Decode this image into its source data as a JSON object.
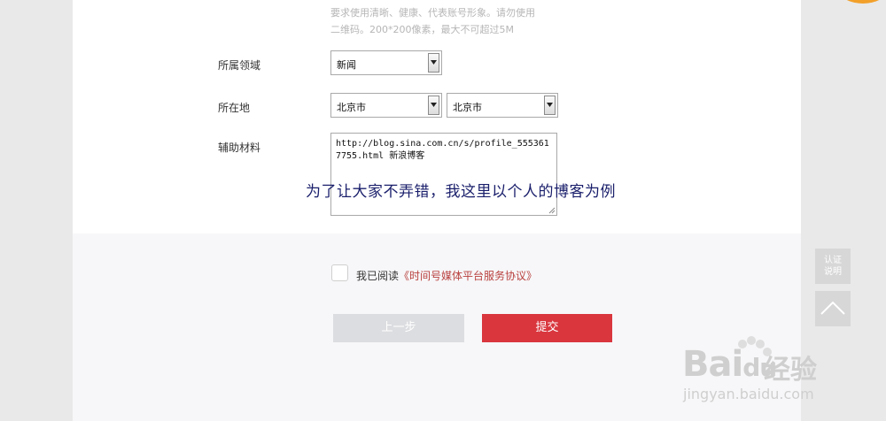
{
  "form": {
    "hint_line1": "要求使用清晰、健康、代表账号形象。请勿使用",
    "hint_line2": "二维码。200*200像素，最大不可超过5M",
    "field_domain_label": "所属领域",
    "field_domain_value": "新闻",
    "field_location_label": "所在地",
    "field_province_value": "北京市",
    "field_city_value": "北京市",
    "field_material_label": "辅助材料",
    "field_material_value": "http://blog.sina.com.cn/s/profile_5553617755.html  新浪博客"
  },
  "annotation": "为了让大家不弄错，我这里以个人的博客为例",
  "agreement": {
    "prefix": "我已阅读",
    "link": "《时间号媒体平台服务协议》",
    "checked": false
  },
  "buttons": {
    "prev": "上一步",
    "submit": "提交"
  },
  "side": {
    "help_line1": "认证",
    "help_line2": "说明"
  },
  "watermark": {
    "brand": "Bai",
    "brand2": "du",
    "cn": "经验",
    "url": "jingyan.baidu.com"
  },
  "colors": {
    "accent": "#d9363e",
    "link": "#b9413f",
    "annotation": "#1a1f6b"
  }
}
